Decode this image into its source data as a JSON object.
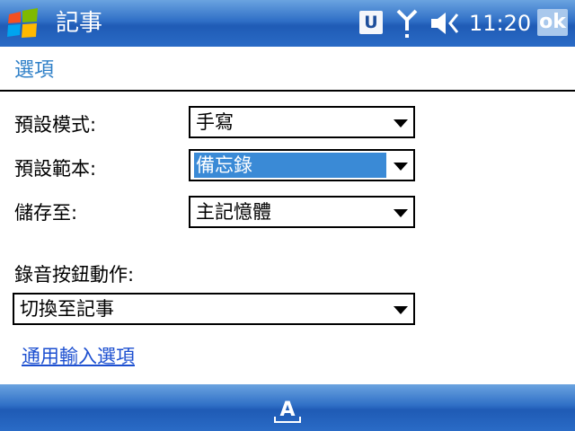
{
  "title_bar": {
    "app_title": "記事",
    "u_badge": "U",
    "time": "11:20",
    "ok_label": "ok",
    "icons": [
      "windows-start-icon",
      "signal-antenna-icon",
      "speaker-muted-icon"
    ]
  },
  "page": {
    "title": "選項"
  },
  "form": {
    "default_mode_label": "預設模式:",
    "default_mode_value": "手寫",
    "default_template_label": "預設範本:",
    "default_template_value": "備忘錄",
    "save_to_label": "儲存至:",
    "save_to_value": "主記憶體",
    "record_button_label": "錄音按鈕動作:",
    "record_button_value": "切換至記事"
  },
  "links": {
    "input_options": "通用輸入選項"
  },
  "bottom_bar": {
    "sip_icon": "keyboard-input-icon",
    "sip_label": "A"
  },
  "colors": {
    "titlebar_blue": "#2f6fc6",
    "selection_blue": "#3a8ad6",
    "link_blue": "#1c4fd0",
    "page_title_blue": "#2f80c8"
  }
}
